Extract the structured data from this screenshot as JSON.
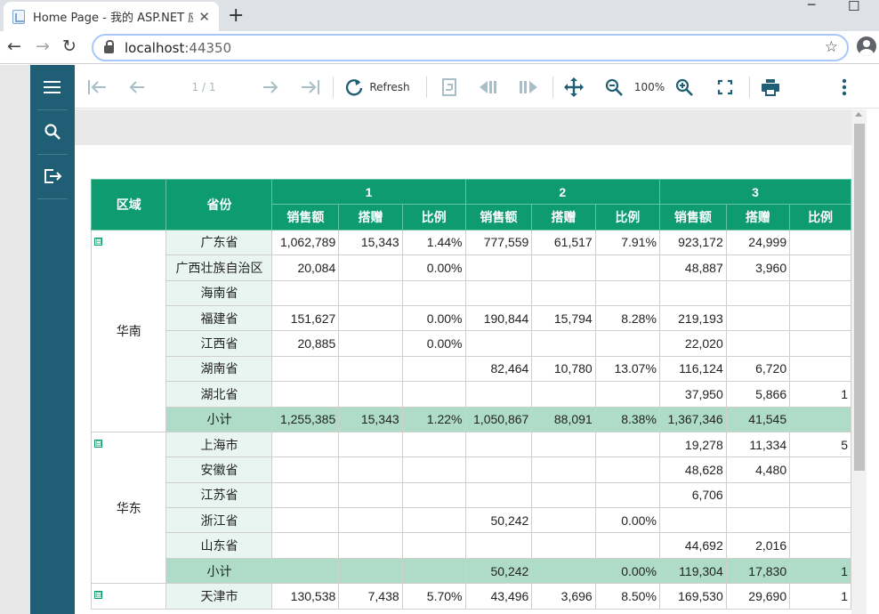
{
  "browser": {
    "tab_title": "Home Page - 我的 ASP.NET 应用程序",
    "tab_close": "✕",
    "new_tab": "+",
    "url_host": "localhost",
    "url_port": ":44350",
    "back": "←",
    "forward": "→",
    "reload": "↻",
    "star": "☆",
    "minimize": "─",
    "maximize": "☐"
  },
  "toolbar": {
    "page_info": "1 / 1",
    "refresh_label": "Refresh",
    "zoom": "100%"
  },
  "colors": {
    "sidebar": "#1f5e74",
    "header_green": "#0e9b70",
    "subtotal_green": "#afdcc9",
    "province_bg": "#e9f5f1"
  },
  "report": {
    "col_region": "区域",
    "col_province": "省份",
    "groups": [
      "1",
      "2",
      "3"
    ],
    "metrics": [
      "销售额",
      "搭赠",
      "比例"
    ],
    "sections": [
      {
        "region": "华南",
        "toggle": "⊟",
        "rows": [
          {
            "province": "广东省",
            "values": [
              "1,062,789",
              "15,343",
              "1.44%",
              "777,559",
              "61,517",
              "7.91%",
              "923,172",
              "24,999",
              ""
            ]
          },
          {
            "province": "广西壮族自治区",
            "values": [
              "20,084",
              "",
              "0.00%",
              "",
              "",
              "",
              "48,887",
              "3,960",
              ""
            ]
          },
          {
            "province": "海南省",
            "values": [
              "",
              "",
              "",
              "",
              "",
              "",
              "",
              "",
              ""
            ]
          },
          {
            "province": "福建省",
            "values": [
              "151,627",
              "",
              "0.00%",
              "190,844",
              "15,794",
              "8.28%",
              "219,193",
              "",
              ""
            ]
          },
          {
            "province": "江西省",
            "values": [
              "20,885",
              "",
              "0.00%",
              "",
              "",
              "",
              "22,020",
              "",
              ""
            ]
          },
          {
            "province": "湖南省",
            "values": [
              "",
              "",
              "",
              "82,464",
              "10,780",
              "13.07%",
              "116,124",
              "6,720",
              ""
            ]
          },
          {
            "province": "湖北省",
            "values": [
              "",
              "",
              "",
              "",
              "",
              "",
              "37,950",
              "5,866",
              "1"
            ]
          }
        ],
        "subtotal": {
          "label": "小计",
          "values": [
            "1,255,385",
            "15,343",
            "1.22%",
            "1,050,867",
            "88,091",
            "8.38%",
            "1,367,346",
            "41,545",
            ""
          ]
        }
      },
      {
        "region": "华东",
        "toggle": "⊟",
        "rows": [
          {
            "province": "上海市",
            "values": [
              "",
              "",
              "",
              "",
              "",
              "",
              "19,278",
              "11,334",
              "5"
            ]
          },
          {
            "province": "安徽省",
            "values": [
              "",
              "",
              "",
              "",
              "",
              "",
              "48,628",
              "4,480",
              ""
            ]
          },
          {
            "province": "江苏省",
            "values": [
              "",
              "",
              "",
              "",
              "",
              "",
              "6,706",
              "",
              ""
            ]
          },
          {
            "province": "浙江省",
            "values": [
              "",
              "",
              "",
              "50,242",
              "",
              "0.00%",
              "",
              "",
              ""
            ]
          },
          {
            "province": "山东省",
            "values": [
              "",
              "",
              "",
              "",
              "",
              "",
              "44,692",
              "2,016",
              ""
            ]
          }
        ],
        "subtotal": {
          "label": "小计",
          "values": [
            "",
            "",
            "",
            "50,242",
            "",
            "0.00%",
            "119,304",
            "17,830",
            "1"
          ]
        }
      },
      {
        "region": "",
        "toggle": "⊟",
        "rows": [
          {
            "province": "天津市",
            "values": [
              "130,538",
              "7,438",
              "5.70%",
              "43,496",
              "3,696",
              "8.50%",
              "169,530",
              "29,690",
              "1"
            ]
          }
        ],
        "subtotal": null
      }
    ]
  }
}
